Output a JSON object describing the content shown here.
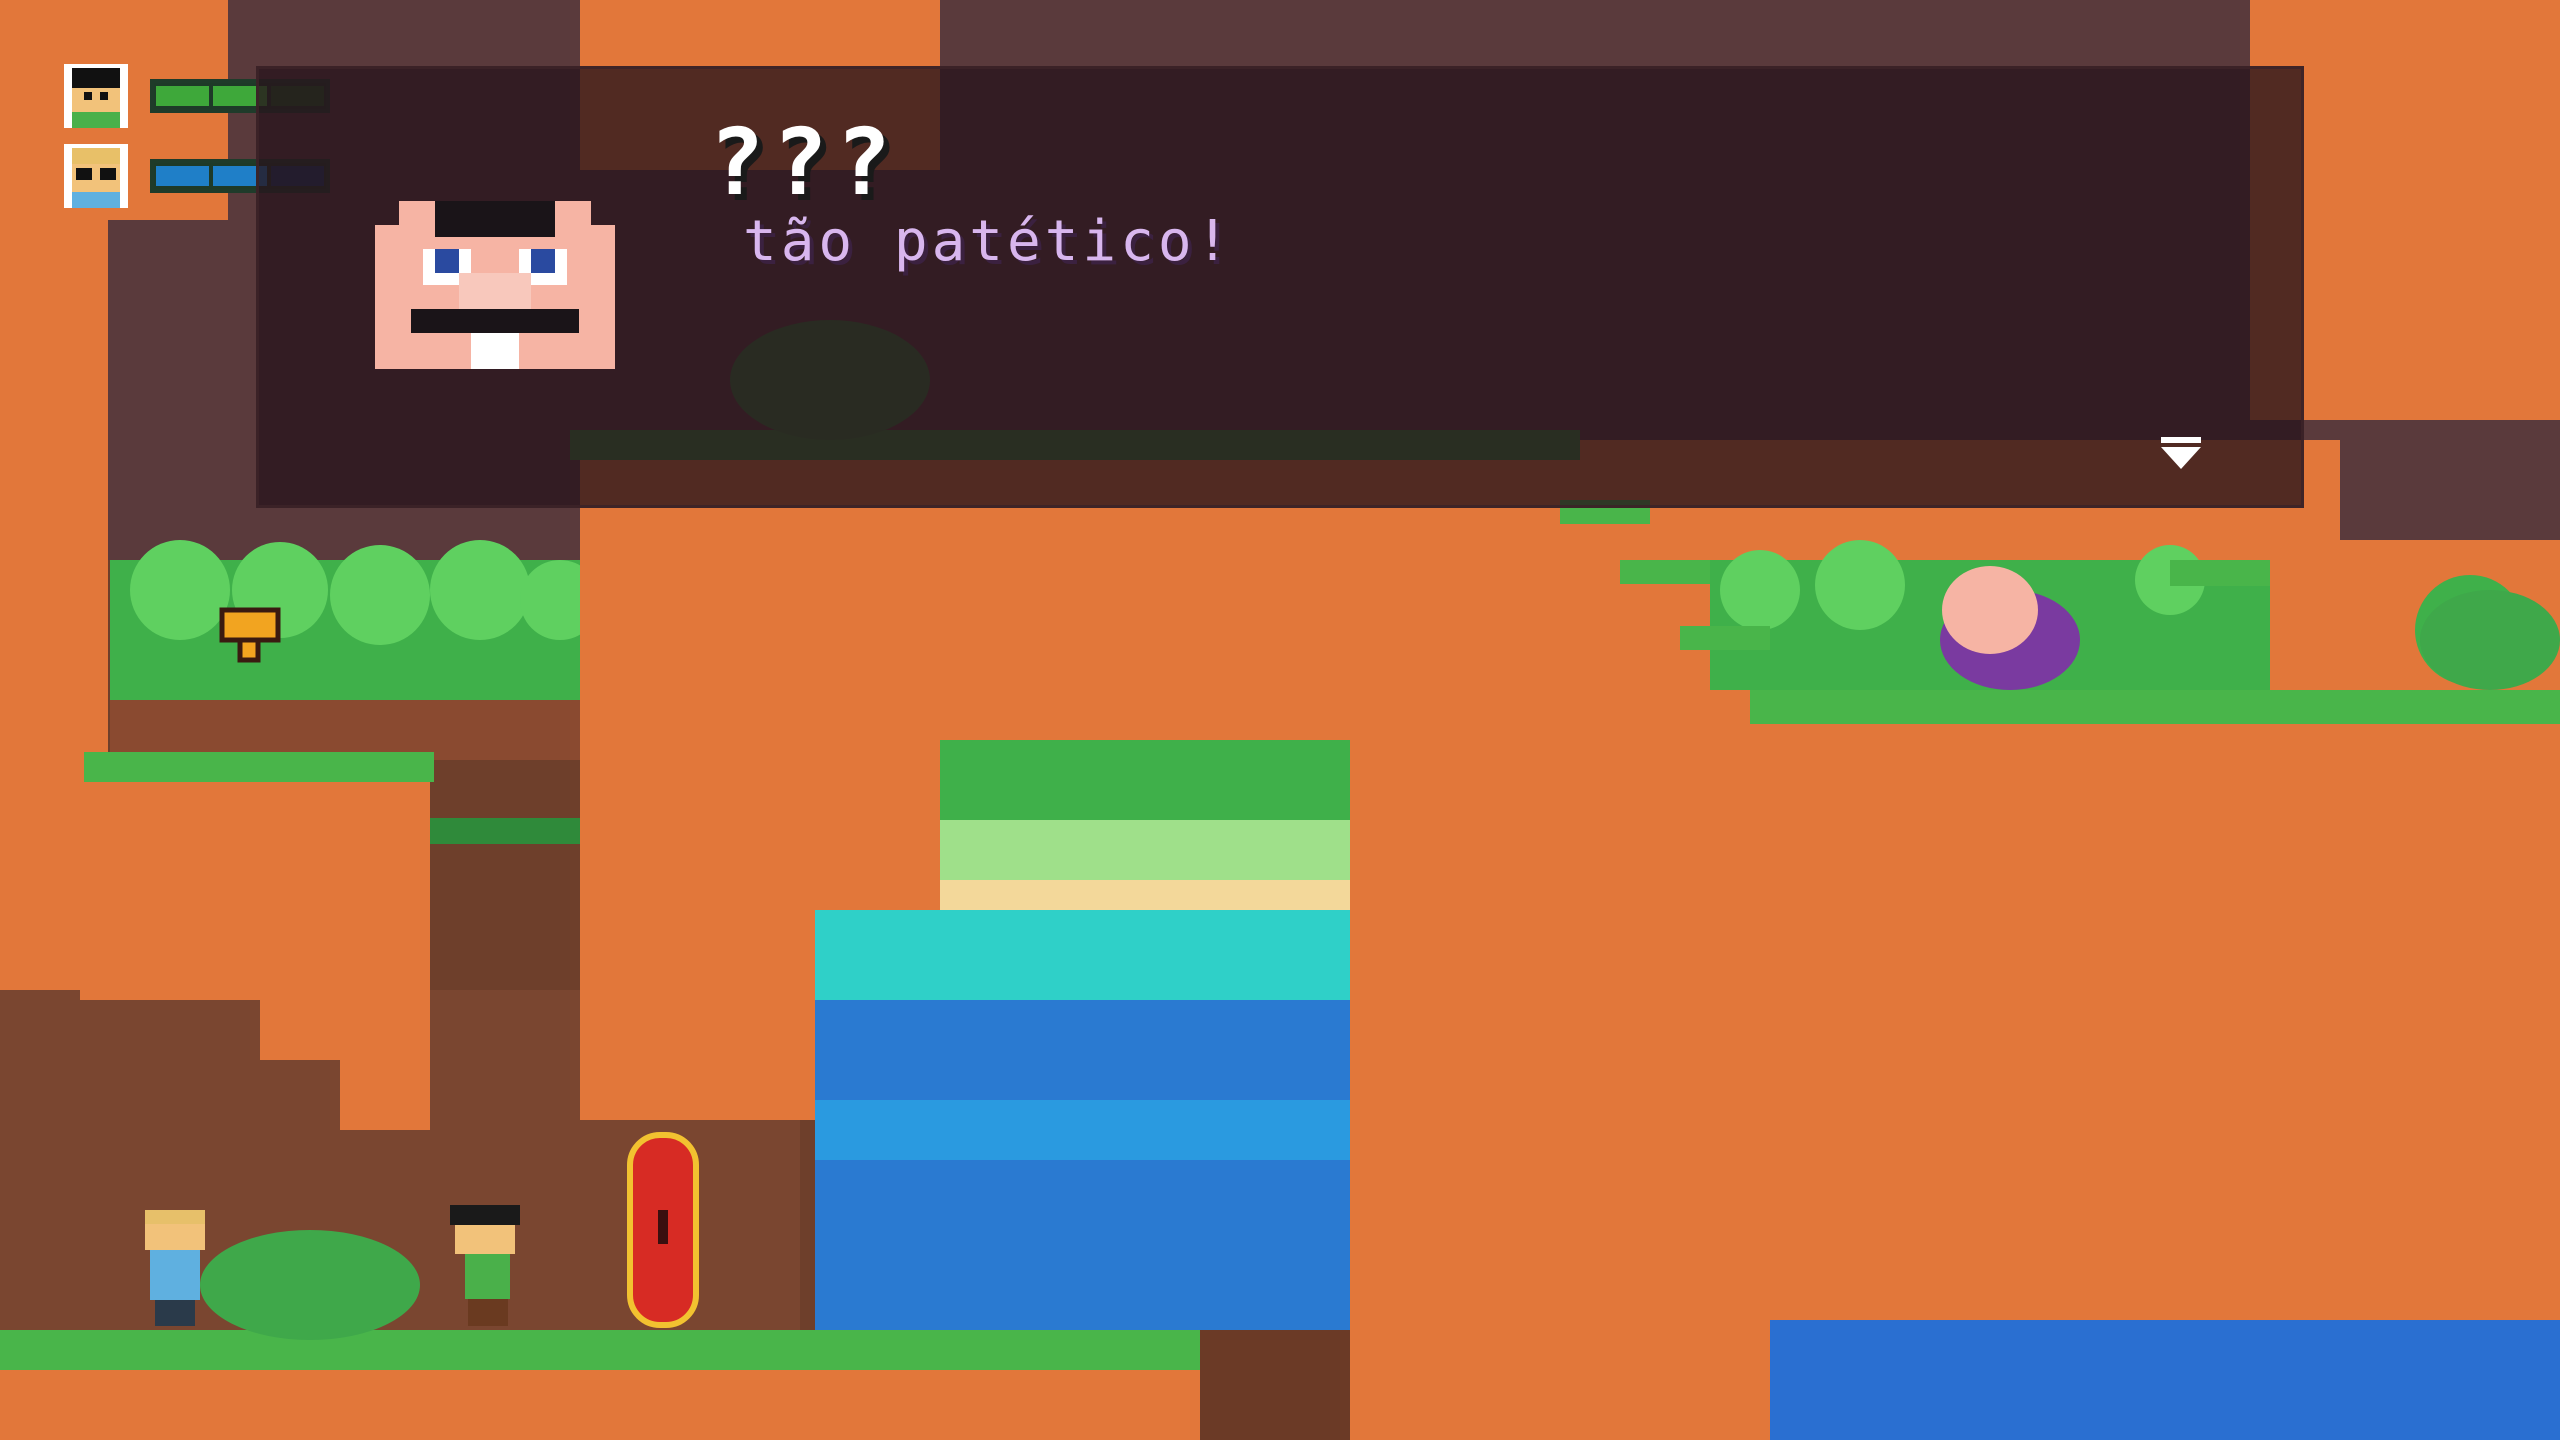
{
  "hud": {
    "players": [
      {
        "name_icon": "boy-black-hair-portrait",
        "bar_color": "#3ea83a",
        "bar_dark": "#1e5a22",
        "segments": 3,
        "filled": 2
      },
      {
        "name_icon": "boy-blonde-glasses-portrait",
        "bar_color": "#1f7fc8",
        "bar_dark": "#123a6a",
        "segments": 3,
        "filled": 2
      }
    ]
  },
  "dialog": {
    "speaker": "???",
    "text": "tão patético!",
    "portrait_icon": "bald-old-man-portrait",
    "advance_icon": "advance-arrow-icon"
  },
  "colors": {
    "dirt": "#e2773a",
    "dirt_dark": "#7a4630",
    "grass": "#2f8a3a",
    "grass_light": "#49b54a",
    "water": "#2a7ad1",
    "water_light": "#2fd0c8",
    "sand": "#f3d89a"
  }
}
